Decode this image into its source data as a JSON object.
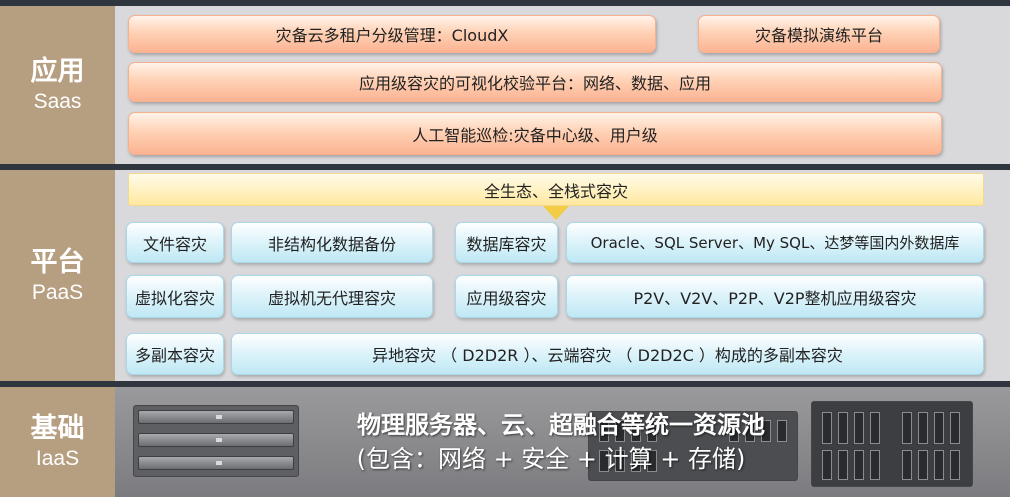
{
  "saas": {
    "label_cn": "应用",
    "label_en": "Saas",
    "items": [
      "灾备云多租户分级管理：CloudX",
      "灾备模拟演练平台",
      "应用级容灾的可视化校验平台：网络、数据、应用",
      "人工智能巡检:灾备中心级、用户级"
    ]
  },
  "paas": {
    "label_cn": "平台",
    "label_en": "PaaS",
    "banner": "全生态、全栈式容灾",
    "rows": [
      [
        "文件容灾",
        "非结构化数据备份",
        "数据库容灾",
        "Oracle、SQL Server、My SQL、达梦等国内外数据库"
      ],
      [
        "虚拟化容灾",
        "虚拟机无代理容灾",
        "应用级容灾",
        "P2V、V2V、P2P、V2P整机应用级容灾"
      ],
      [
        "多副本容灾",
        "异地容灾 （ D2D2R ）、云端容灾 （ D2D2C ）构成的多副本容灾"
      ]
    ]
  },
  "iaas": {
    "label_cn": "基础",
    "label_en": "IaaS",
    "title": "物理服务器、云、超融合等统一资源池",
    "subtitle": "(包含：网络 + 安全 + 计算 + 存储)"
  },
  "colors": {
    "label_bg": "#b69e80",
    "saas_box": "#fbb392",
    "paas_box": "#bfe8f4",
    "banner": "#ffe79f",
    "background": "#2f3640"
  }
}
